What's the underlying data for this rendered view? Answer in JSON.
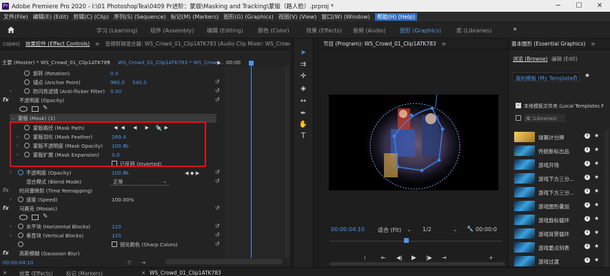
{
  "title_bar": {
    "app_title": "Adobe Premiere Pro 2020 - I:\\01 PhotoshopTea\\0409 Pr进阶：蒙版\\Masking and Tracking\\蒙版（路人脸）.prproj *",
    "minimize": "─",
    "maximize": "☐",
    "close": "✕"
  },
  "menu": [
    "文件(File)",
    "编辑(E) (Edit)",
    "剪辑(C) (Clip)",
    "序列(S) (Sequence)",
    "标记(M) (Markers)",
    "图形(G) (Graphics)",
    "视图(V) (View)",
    "窗口(W) (Window)",
    "帮助(H) (Help)"
  ],
  "workspaces": [
    {
      "label": "学习 (Learning)",
      "active": false
    },
    {
      "label": "组件 (Assembly)",
      "active": false
    },
    {
      "label": "编辑 (Editing)",
      "active": false
    },
    {
      "label": "颜色 (Color)",
      "active": false
    },
    {
      "label": "效果 (Effects)",
      "active": false
    },
    {
      "label": "音频 (Audio)",
      "active": false
    },
    {
      "label": "图形 (Graphics)",
      "active": true
    },
    {
      "label": "库 (Libraries)",
      "active": false
    }
  ],
  "ws_more": "»",
  "left_tabs": {
    "t0": "copes)",
    "t1": "效果控件 (Effect Controls)",
    "t1_menu": "≡",
    "t2": "音频剪辑混合器: WS_Crowd_01_Clip1ATK783 (Audio Clip Mixer: WS_Crowd",
    "more": "»"
  },
  "ec_header": {
    "master": "主要 (Master) * WS_Crowd_01_Clip1ATK783",
    "seq": "WS_Crowd_01_Clip1ATK783 * WS_Crowd...",
    "time": "00:00"
  },
  "ec": {
    "rotation": {
      "label": "旋转 (Rotation)",
      "value": "0.0"
    },
    "anchor": {
      "label": "锚点 (Anchor Point)",
      "x": "960.0",
      "y": "540.0"
    },
    "antiflicker": {
      "label": "防闪烁滤镜 (Anti-flicker Filter)",
      "value": "0.00"
    },
    "opacity_fx": {
      "label": "不透明度 (Opacity)"
    },
    "mask1": {
      "label": "蒙版 (Mask) (1)"
    },
    "mask_path": {
      "label": "蒙版路径 (Mask Path)"
    },
    "mask_feather": {
      "label": "蒙版羽化 (Mask Feather)",
      "value": "269.4"
    },
    "mask_opacity": {
      "label": "蒙版不透明度 (Mask Opacity)",
      "value": "100.0",
      "unit": "%"
    },
    "mask_expansion": {
      "label": "蒙版扩展 (Mask Expansion)",
      "value": "0.0"
    },
    "inverted": {
      "label": "已反转 (Inverted)"
    },
    "opacity": {
      "label": "不透明度 (Opacity)",
      "value": "100.0",
      "unit": "%"
    },
    "blend": {
      "label": "混合模式 (Blend Mode)",
      "value": "正常"
    },
    "time_remap": {
      "label": "时间重映射 (Time Remapping)"
    },
    "speed": {
      "label": "速度 (Speed)",
      "value": "100.00%"
    },
    "mosaic": {
      "label": "马赛克 (Mosaic)"
    },
    "hblocks": {
      "label": "水平块 (Horizontal Blocks)",
      "value": "120"
    },
    "vblocks": {
      "label": "垂直块 (Vertical Blocks)",
      "value": "120"
    },
    "sharp": {
      "label": "锐化颜色 (Sharp Colors)"
    },
    "gblur": {
      "label": "高斯模糊 (Gaussian Blur)"
    },
    "timecode": "00:00:04:10"
  },
  "program": {
    "tab": "节目 (Program): WS_Crowd_01_Clip1ATK783",
    "menu_icon": "≡",
    "timecode": "00:00:04:10",
    "fit": "适合 (Fit)",
    "quality": "1/2",
    "duration": "00:00:0"
  },
  "essential": {
    "tab": "基本图形 (Essential Graphics)",
    "menu_icon": "≡",
    "browse": "浏览 (Browse)",
    "edit": "编辑 (Edit)",
    "templates_select": "我的模板 (My Templates)",
    "local_templates": "本地模板文件夹 (Local Templates F",
    "libraries": "库 (Libraries)",
    "items": [
      "球赛计分牌",
      "传统新标出品",
      "游戏开场",
      "游戏下方三分...",
      "游戏下方三分...",
      "游戏图形叠加",
      "游戏旋标循环",
      "游戏背景循环",
      "游戏要点列表",
      "游戏过渡"
    ]
  },
  "bottom_tabs": {
    "effects": "效果 (Effects)",
    "markers": "标记 (Markers)",
    "timeline": "WS_Crowd_01_Clip1ATK783"
  },
  "colors": {
    "accent_blue": "#4f93e6",
    "mask_highlight": "#e0141a",
    "panel_bg": "#232323"
  }
}
